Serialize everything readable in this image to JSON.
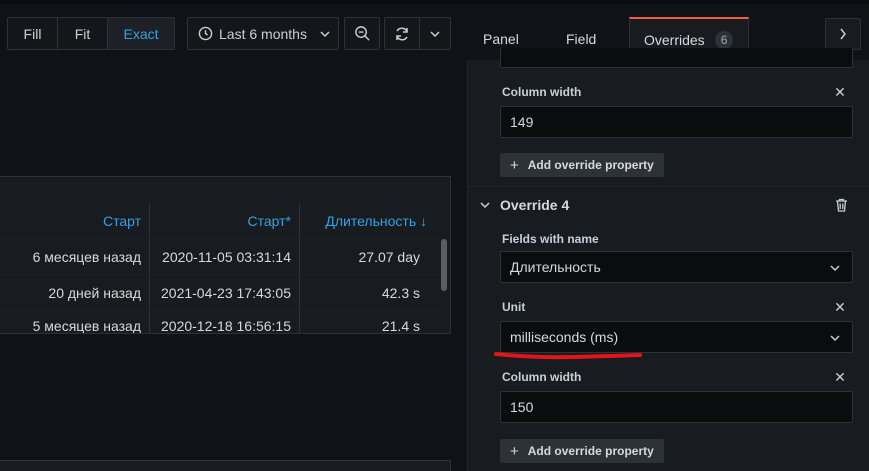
{
  "toolbar": {
    "zoom_modes": [
      "Fill",
      "Fit",
      "Exact"
    ],
    "active_zoom": "Exact",
    "time_range": "Last 6 months"
  },
  "table": {
    "headers": [
      "Старт",
      "Старт*",
      "Длительность ↓"
    ],
    "rows": [
      [
        "6 месяцев назад",
        "2020-11-05 03:31:14",
        "27.07 day"
      ],
      [
        "20 дней назад",
        "2021-04-23 17:43:05",
        "42.3 s"
      ],
      [
        "5 месяцев назад",
        "2020-12-18 16:56:15",
        "21.4 s"
      ]
    ]
  },
  "options": {
    "tabs": [
      "Panel",
      "Field",
      "Overrides"
    ],
    "active_tab": "Overrides",
    "overrides_count": "6",
    "prev_property": {
      "label": "Column width",
      "value": "149"
    },
    "add_override_label": "Add override property",
    "override4": {
      "title": "Override 4",
      "matcher_label": "Fields with name",
      "matcher_value": "Длительность",
      "unit_label": "Unit",
      "unit_value": "milliseconds (ms)",
      "width_label": "Column width",
      "width_value": "150"
    }
  },
  "colors": {
    "accent": "#33a2e5",
    "tab_highlight": "#f55f3e",
    "annotation_red": "#e0161a"
  }
}
